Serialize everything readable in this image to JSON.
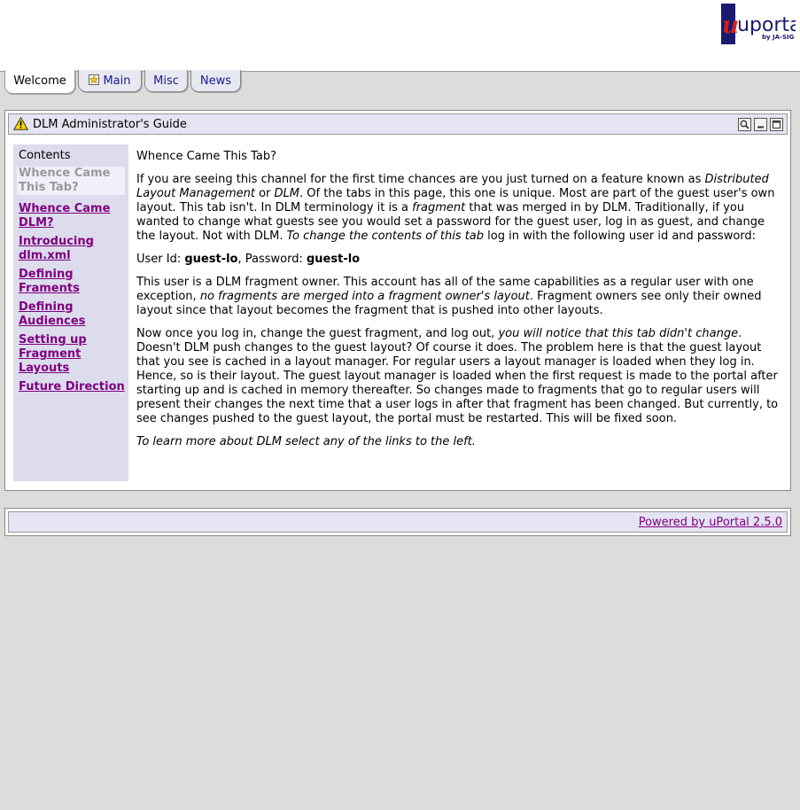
{
  "logo": {
    "brand": "uportal",
    "by": "by JA-SIG"
  },
  "tabs": [
    {
      "label": "Welcome",
      "active": true
    },
    {
      "label": "Main",
      "icon": "star-icon"
    },
    {
      "label": "Misc"
    },
    {
      "label": "News"
    }
  ],
  "channel": {
    "title": "DLM Administrator's Guide",
    "controls": [
      "help-icon",
      "minimize-icon",
      "maximize-icon"
    ]
  },
  "sidebar": {
    "title": "Contents",
    "current": "Whence Came This Tab?",
    "links": [
      "Whence Came DLM?",
      "Introducing dlm.xml",
      "Defining Framents",
      "Defining Audiences",
      "Setting up Fragment Layouts",
      "Future Direction"
    ]
  },
  "content": {
    "heading": "Whence Came This Tab?",
    "p1": {
      "t1": "If you are seeing this channel for the first time chances are you just turned on a feature known as ",
      "e1": "Distributed Layout Management",
      "t2": " or ",
      "e2": "DLM",
      "t3": ". Of the tabs in this page, this one is unique. Most are part of the guest user's own layout. This tab isn't. In DLM terminology it is a ",
      "e3": "fragment",
      "t4": " that was merged in by DLM. Traditionally, if you wanted to change what guests see you would set a password for the guest user, log in as guest, and change the layout. Not with DLM. ",
      "e4": "To change the contents of this tab",
      "t5": " log in with the following user id and password:"
    },
    "creds": {
      "user_label": "User Id: ",
      "user_value": "guest-lo",
      "sep": ", Password: ",
      "pass_value": "guest-lo"
    },
    "p3": {
      "t1": "This user is a DLM fragment owner. This account has all of the same capabilities as a regular user with one exception, ",
      "e1": "no fragments are merged into a fragment owner's layout",
      "t2": ". Fragment owners see only their owned layout since that layout becomes the fragment that is pushed into other layouts."
    },
    "p4": {
      "t1": "Now once you log in, change the guest fragment, and log out, ",
      "e1": "you will notice that this tab didn't change",
      "t2": ". Doesn't DLM push changes to the guest layout? Of course it does. The problem here is that the guest layout that you see is cached in a layout manager. For regular users a layout manager is loaded when they log in. Hence, so is their layout. The guest layout manager is loaded when the first request is made to the portal after starting up and is cached in memory thereafter. So changes made to fragments that go to regular users will present their changes the next time that a user logs in after that fragment has been changed. But currently, to see changes pushed to the guest layout, the portal must be restarted. This will be fixed soon."
    },
    "p5": "To learn more about DLM select any of the links to the left."
  },
  "footer": {
    "powered": "Powered by uPortal 2.5.0"
  }
}
